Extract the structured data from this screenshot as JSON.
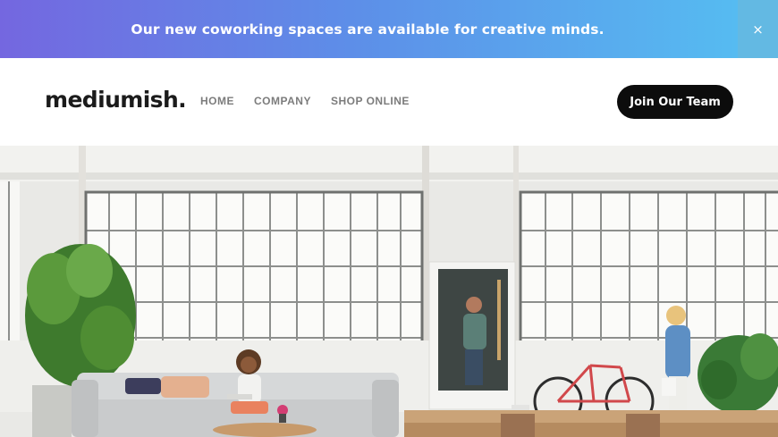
{
  "announcement": {
    "text": "Our new coworking spaces are available for creative minds.",
    "close_icon": "close-icon",
    "close_glyph": "×"
  },
  "header": {
    "logo": "mediumish.",
    "nav": [
      {
        "label": "HOME"
      },
      {
        "label": "COMPANY"
      },
      {
        "label": "SHOP ONLINE"
      }
    ],
    "cta_label": "Join Our Team"
  },
  "hero": {
    "image": "coworking-office-photo"
  },
  "colors": {
    "banner_gradient_start": "#7467e0",
    "banner_gradient_end": "#55c0f2",
    "cta_background": "#0c0c0c",
    "nav_text": "#7c7c7c"
  }
}
